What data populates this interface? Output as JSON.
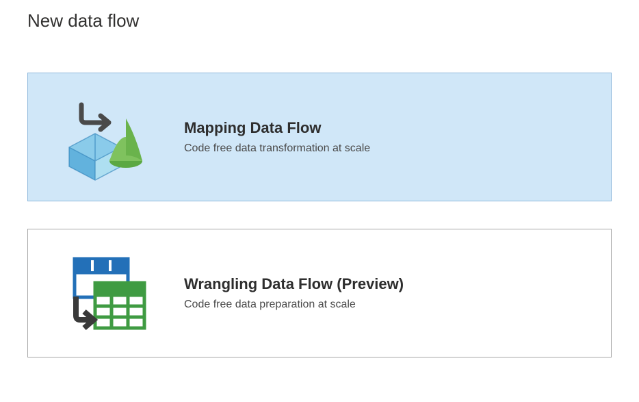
{
  "page": {
    "title": "New data flow"
  },
  "options": [
    {
      "title": "Mapping Data Flow",
      "description": "Code free data transformation at scale",
      "selected": true
    },
    {
      "title": "Wrangling Data Flow (Preview)",
      "description": "Code free data preparation at scale",
      "selected": false
    }
  ]
}
